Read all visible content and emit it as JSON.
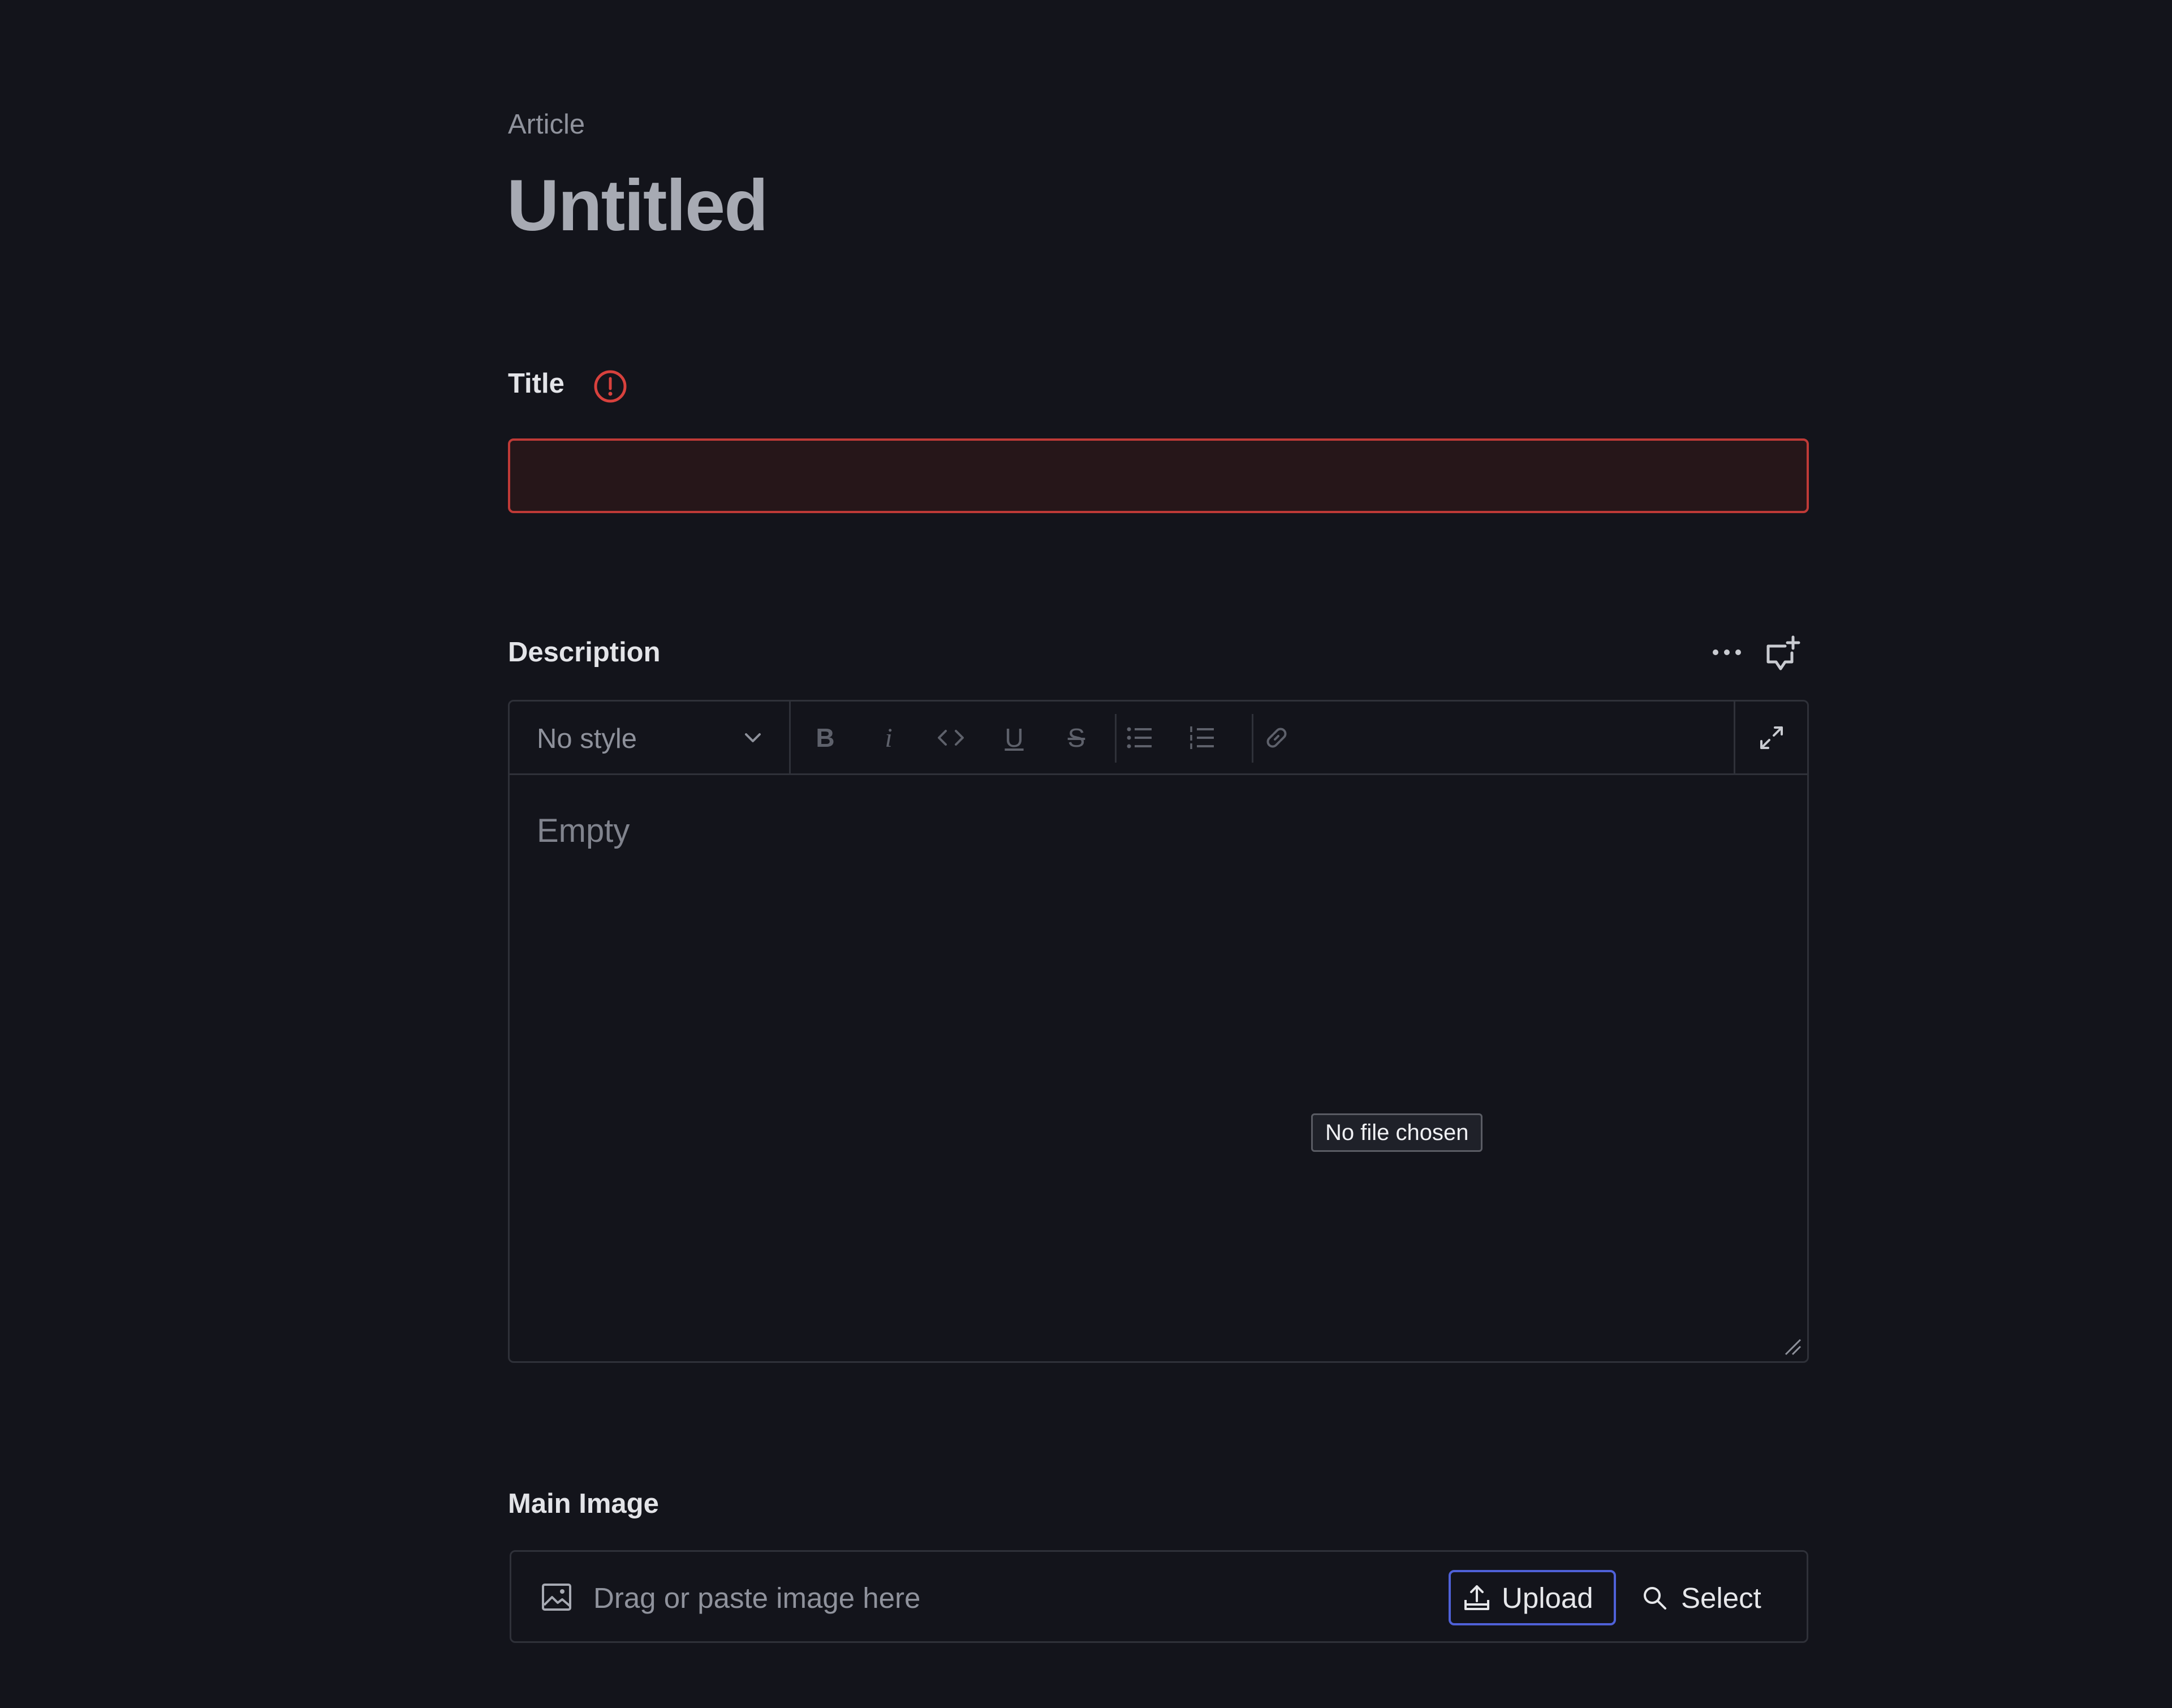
{
  "header": {
    "document_type": "Article",
    "document_title": "Untitled"
  },
  "fields": {
    "title": {
      "label": "Title",
      "value": "",
      "status": "error",
      "status_icon": "warning-circle-icon"
    },
    "description": {
      "label": "Description",
      "actions": [
        "more-icon",
        "add-comment-icon"
      ],
      "editor": {
        "style_select": "No style",
        "toolbar": [
          "bold-icon",
          "italic-icon",
          "code-icon",
          "underline-icon",
          "strikethrough-icon",
          "bullet-list-icon",
          "numbered-list-icon",
          "link-icon",
          "fullscreen-icon"
        ],
        "placeholder": "Empty"
      }
    },
    "main_image": {
      "label": "Main Image",
      "placeholder": "Drag or paste image here",
      "upload_label": "Upload",
      "select_label": "Select"
    }
  },
  "tooltip": {
    "text": "No file chosen"
  },
  "colors": {
    "background": "#13141b",
    "error_border": "#bf3a37",
    "error_fill": "#261619",
    "accent_focus": "#4f61d8"
  }
}
